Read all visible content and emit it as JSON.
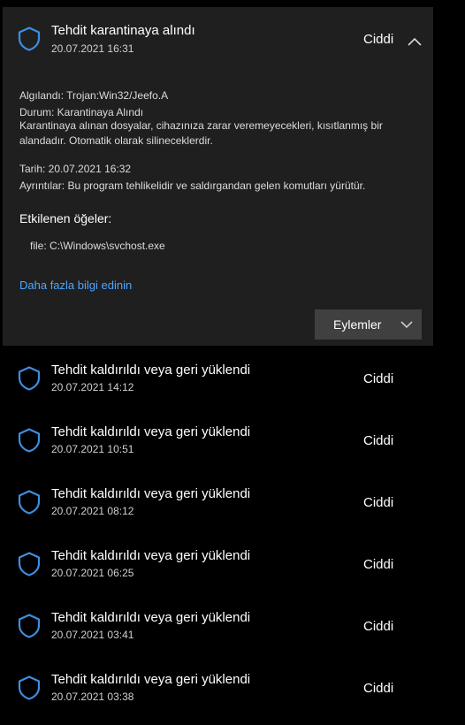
{
  "colors": {
    "background": "#000000",
    "panel": "#1f1f1f",
    "accent_shield": "#3c8fe0",
    "link": "#4ca6ff",
    "button": "#404040"
  },
  "expanded_item": {
    "title": "Tehdit karantinaya alındı",
    "date": "20.07.2021 16:31",
    "severity": "Ciddi",
    "icon": "shield-icon",
    "toggle_icon": "chevron-up-icon",
    "detected_line": "Algılandı:  Trojan:Win32/Jeefo.A",
    "status_line": "Durum:  Karantinaya Alındı",
    "description": "Karantinaya alınan dosyalar, cihazınıza zarar veremeyecekleri, kısıtlanmış bir alandadır. Otomatik olarak silineceklerdir.",
    "date_line": "Tarih:  20.07.2021 16:32",
    "details_line": "Ayrıntılar:  Bu program tehlikelidir ve saldırgandan gelen komutları yürütür.",
    "affected_heading": "Etkilenen öğeler:",
    "affected_file": "file: C:\\Windows\\svchost.exe",
    "more_info_link": "Daha fazla bilgi edinin",
    "actions_button": "Eylemler",
    "actions_icon": "chevron-down-icon"
  },
  "items": [
    {
      "title": "Tehdit kaldırıldı veya geri yüklendi",
      "date": "20.07.2021 14:12",
      "severity": "Ciddi"
    },
    {
      "title": "Tehdit kaldırıldı veya geri yüklendi",
      "date": "20.07.2021 10:51",
      "severity": "Ciddi"
    },
    {
      "title": "Tehdit kaldırıldı veya geri yüklendi",
      "date": "20.07.2021 08:12",
      "severity": "Ciddi"
    },
    {
      "title": "Tehdit kaldırıldı veya geri yüklendi",
      "date": "20.07.2021 06:25",
      "severity": "Ciddi"
    },
    {
      "title": "Tehdit kaldırıldı veya geri yüklendi",
      "date": "20.07.2021 03:41",
      "severity": "Ciddi"
    },
    {
      "title": "Tehdit kaldırıldı veya geri yüklendi",
      "date": "20.07.2021 03:38",
      "severity": "Ciddi"
    }
  ]
}
